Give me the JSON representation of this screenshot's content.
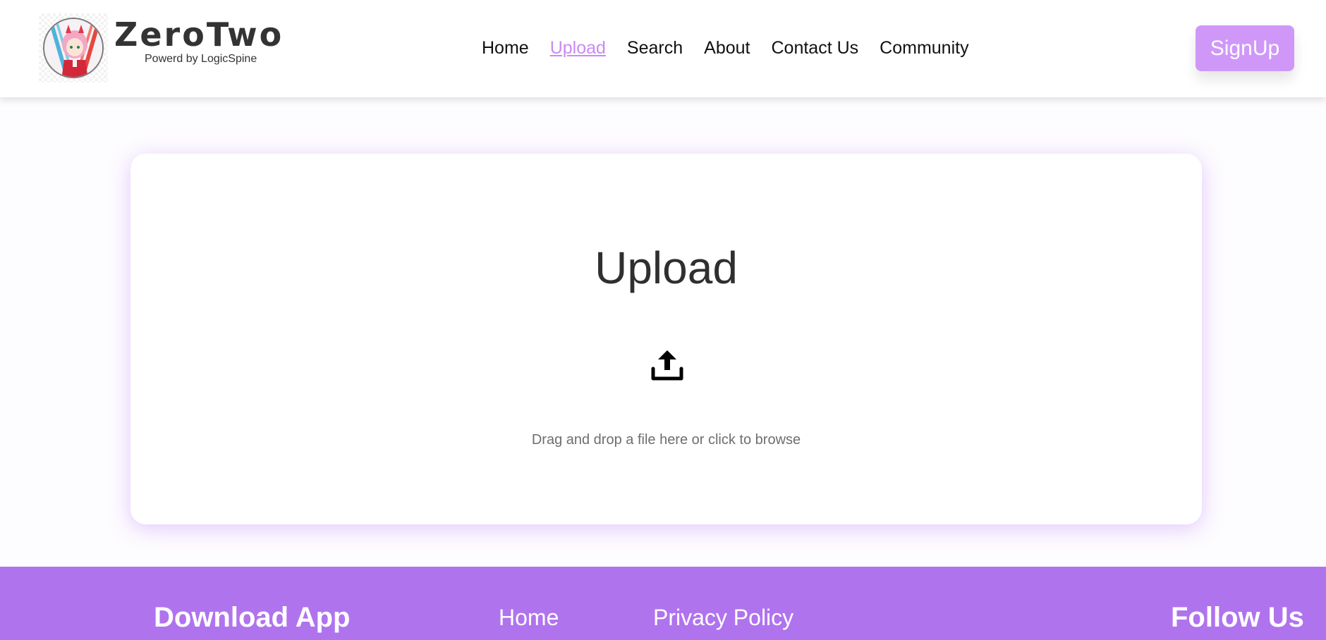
{
  "brand": {
    "name": "ZeroTwo",
    "subtitle": "Powerd by LogicSpine"
  },
  "nav": {
    "items": [
      {
        "label": "Home",
        "active": false
      },
      {
        "label": "Upload",
        "active": true
      },
      {
        "label": "Search",
        "active": false
      },
      {
        "label": "About",
        "active": false
      },
      {
        "label": "Contact Us",
        "active": false
      },
      {
        "label": "Community",
        "active": false
      }
    ],
    "signup_label": "SignUp"
  },
  "upload": {
    "title": "Upload",
    "icon": "upload-icon",
    "hint": "Drag and drop a file here or click to browse"
  },
  "footer": {
    "download_heading": "Download App",
    "links": [
      "Home",
      "Privacy Policy"
    ],
    "follow_heading": "Follow Us"
  },
  "colors": {
    "accent": "#cf98f8",
    "active_link": "#c98af6",
    "footer_bg": "#b073ee",
    "card_glow": "#c48cfa"
  }
}
